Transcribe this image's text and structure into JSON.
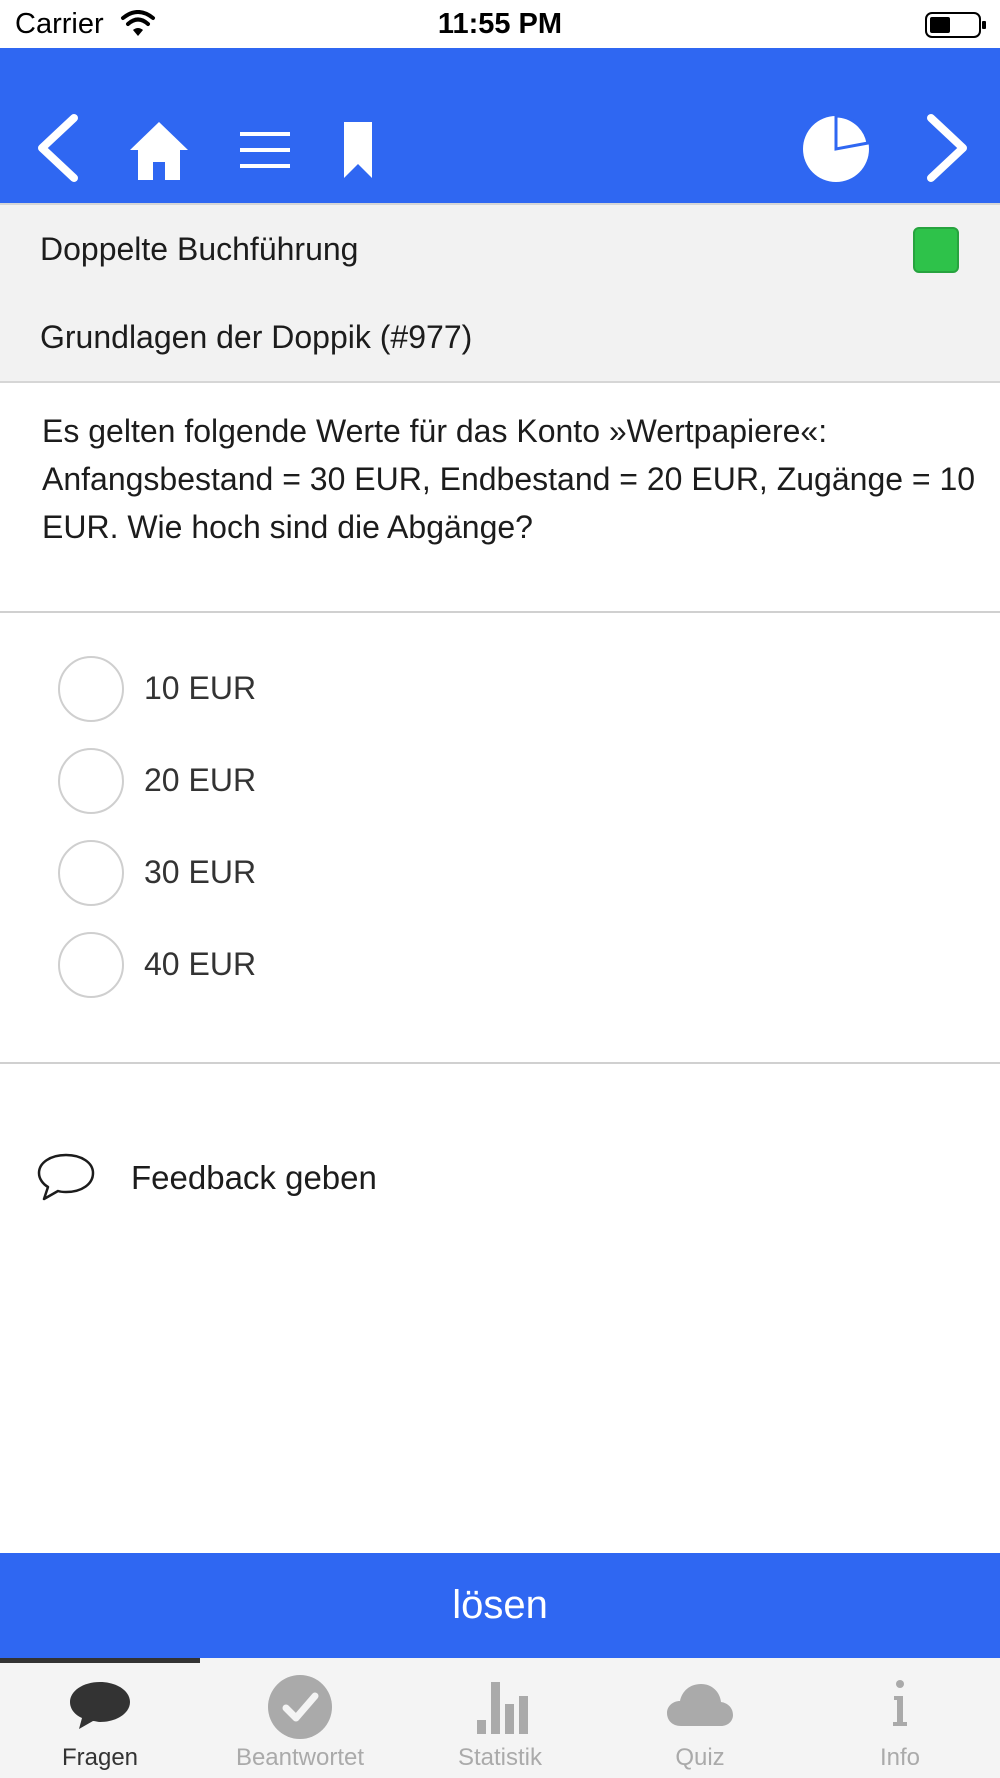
{
  "status_bar": {
    "carrier": "Carrier",
    "time": "11:55 PM"
  },
  "toolbar": {
    "icons": [
      "chevron-left-icon",
      "home-icon",
      "menu-icon",
      "bookmark-icon",
      "progress-pie-icon",
      "chevron-right-icon"
    ],
    "color": "#2f67f2"
  },
  "category": {
    "title": "Doppelte Buchführung",
    "status_color": "#2ec24a"
  },
  "topic": {
    "title": "Grundlagen der Doppik (#977)"
  },
  "question": {
    "text": "Es gelten folgende Werte für das Konto »Wertpapiere«: Anfangsbestand = 30 EUR, Endbestand = 20 EUR, Zugänge = 10 EUR. Wie hoch sind die Abgänge?"
  },
  "answers": [
    {
      "label": "10 EUR"
    },
    {
      "label": "20 EUR"
    },
    {
      "label": "30 EUR"
    },
    {
      "label": "40 EUR"
    }
  ],
  "feedback": {
    "label": "Feedback geben",
    "icon": "speech-bubble-icon"
  },
  "solve_button": {
    "label": "lösen"
  },
  "tabs": [
    {
      "label": "Fragen",
      "icon": "chat-bubble-icon",
      "active": true
    },
    {
      "label": "Beantwortet",
      "icon": "checkmark-circle-icon",
      "active": false
    },
    {
      "label": "Statistik",
      "icon": "bar-chart-icon",
      "active": false
    },
    {
      "label": "Quiz",
      "icon": "cloud-icon",
      "active": false
    },
    {
      "label": "Info",
      "icon": "info-icon",
      "active": false
    }
  ]
}
